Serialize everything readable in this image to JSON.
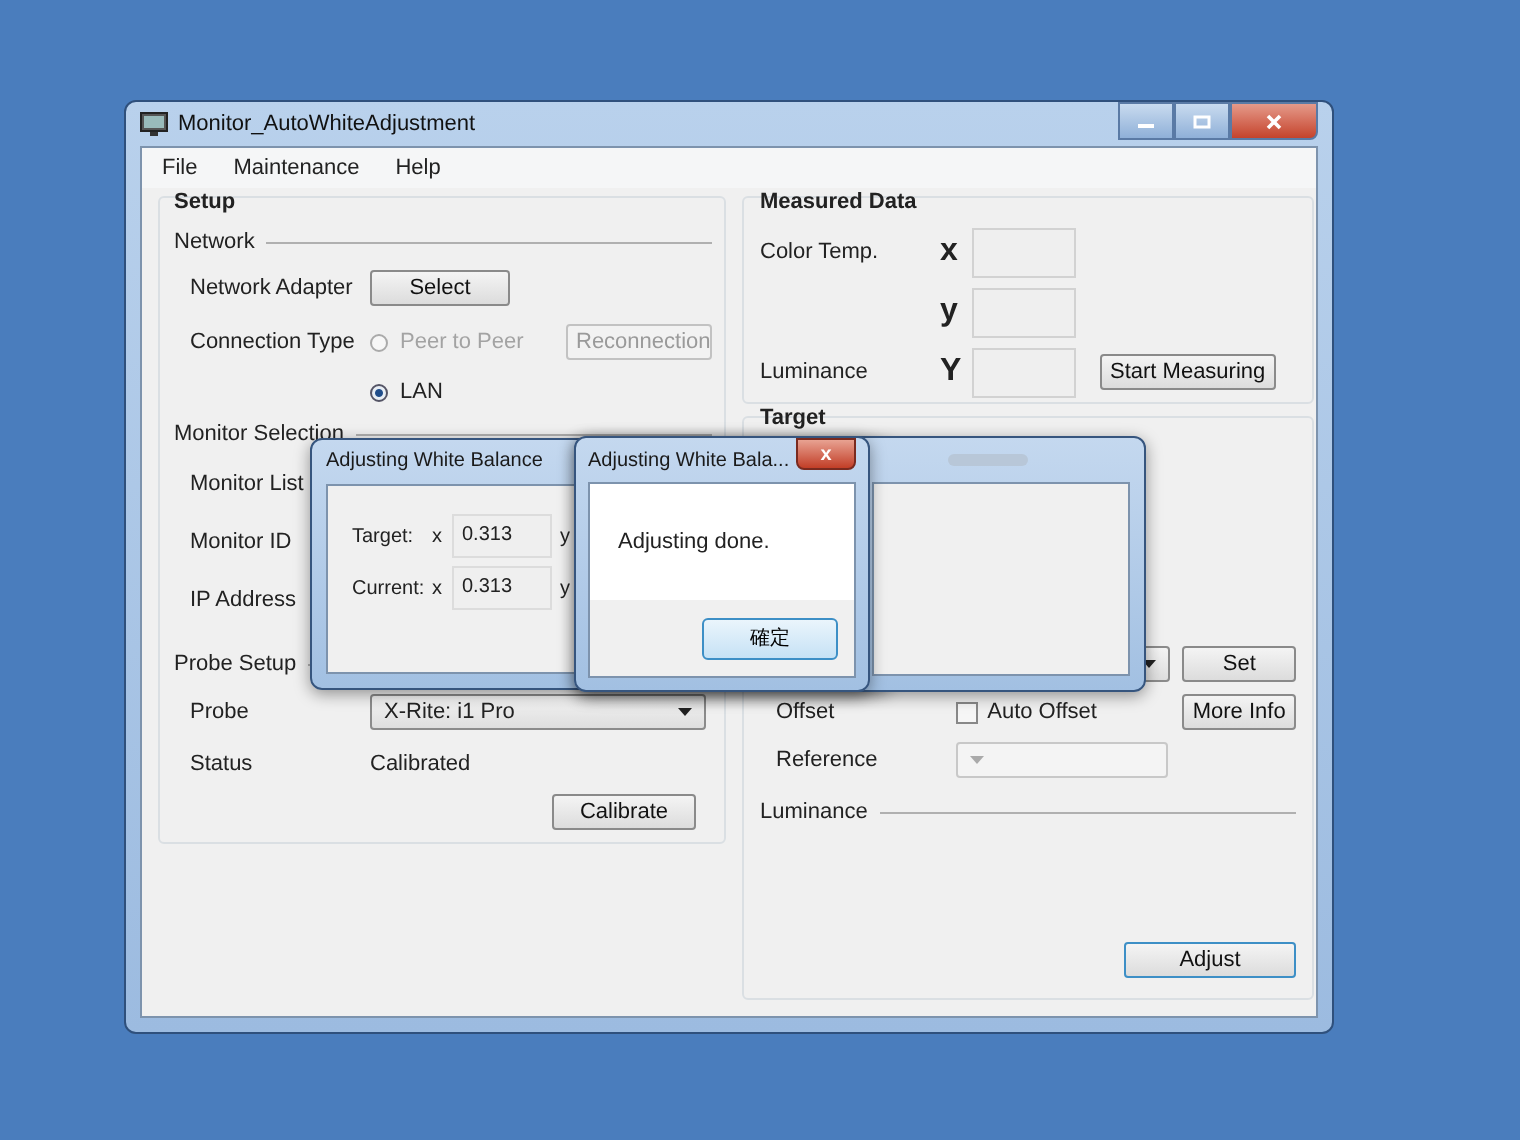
{
  "window": {
    "title": "Monitor_AutoWhiteAdjustment"
  },
  "menu": [
    "File",
    "Maintenance",
    "Help"
  ],
  "setup": {
    "title": "Setup",
    "network": {
      "title": "Network",
      "adapter_label": "Network Adapter",
      "select_button": "Select",
      "connection_label": "Connection Type",
      "options": [
        {
          "label": "Peer to Peer",
          "selected": false,
          "disabled": true
        },
        {
          "label": "LAN",
          "selected": true,
          "disabled": false
        }
      ],
      "reconnect_button": {
        "label": "Reconnection",
        "disabled": true
      }
    },
    "monitor_selection": {
      "title": "Monitor Selection",
      "labels": [
        "Monitor List",
        "Monitor ID",
        "IP Address"
      ]
    },
    "probe": {
      "title": "Probe Setup",
      "probe_label": "Probe",
      "probe_value": "X-Rite: i1 Pro",
      "status_label": "Status",
      "status_value": "Calibrated",
      "calibrate_button": "Calibrate"
    }
  },
  "measured": {
    "title": "Measured Data",
    "rows": [
      {
        "label": "Color Temp.",
        "symbol": "x"
      },
      {
        "symbol": "y"
      },
      {
        "label": "Luminance",
        "symbol": "Y"
      }
    ],
    "start_button": "Start Measuring"
  },
  "target": {
    "title": "Target",
    "set_button": "Set",
    "offset_label": "Offset",
    "auto_offset": {
      "label": "Auto Offset",
      "checked": false
    },
    "more_info_button": "More Info",
    "reference_label": "Reference",
    "luminance_title": "Luminance",
    "adjust_button": "Adjust"
  },
  "balance_dialog": {
    "title": "Adjusting White Balance",
    "rows": [
      {
        "label": "Target:",
        "axis": "x",
        "value": "0.313",
        "next_axis": "y"
      },
      {
        "label": "Current:",
        "axis": "x",
        "value": "0.313",
        "next_axis": "y"
      }
    ]
  },
  "message_dialog": {
    "title": "Adjusting White Bala...",
    "close": "x",
    "message": "Adjusting done.",
    "ok_button": "確定"
  }
}
